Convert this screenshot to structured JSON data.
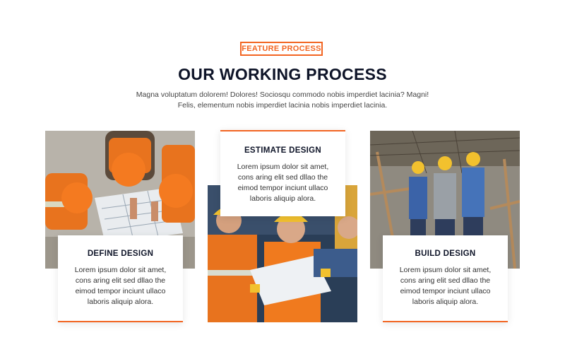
{
  "section": {
    "badge": "FEATURE PROCESS",
    "title": "OUR WORKING PROCESS",
    "intro_line1": "Magna voluptatum dolorem! Dolores! Sociosqu commodo nobis imperdiet lacinia? Magni!",
    "intro_line2": "Felis, elementum nobis imperdiet lacinia nobis imperdiet lacinia."
  },
  "cards": [
    {
      "title": "DEFINE DESIGN",
      "text_lines": [
        "Lorem ipsum dolor sit amet,",
        "cons aring elit sed dllao the",
        "eimod tempor inciunt ullaco",
        "laboris aliquip alora."
      ]
    },
    {
      "title": "ESTIMATE DESIGN",
      "text_lines": [
        "Lorem ipsum dolor sit amet,",
        "cons aring elit sed dllao the",
        "eimod tempor inciunt ullaco",
        "laboris aliquip alora."
      ]
    },
    {
      "title": "BUILD DESIGN",
      "text_lines": [
        "Lorem ipsum dolor sit amet,",
        "cons aring elit sed dllao the",
        "eimod tempor inciunt ullaco",
        "laboris aliquip alora."
      ]
    }
  ],
  "colors": {
    "accent": "#f26522",
    "heading": "#0e1428"
  },
  "images": [
    "workers-blueprint-photo",
    "engineers-discussion-photo",
    "builders-site-photo"
  ]
}
